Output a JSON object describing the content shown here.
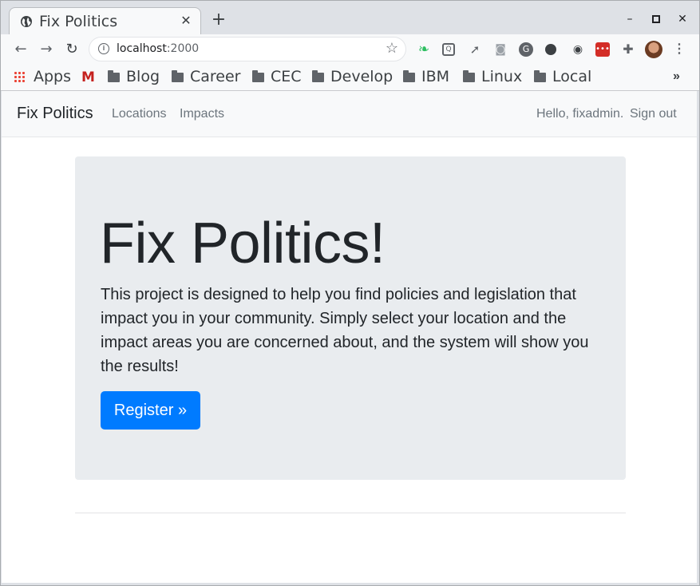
{
  "browser": {
    "tab": {
      "title": "Fix Politics",
      "close": "✕"
    },
    "new_tab": "+",
    "window_controls": {
      "minimize": "–",
      "maximize": "◻",
      "close": "✕"
    },
    "nav": {
      "back": "←",
      "forward": "→",
      "reload": "↻"
    },
    "address": {
      "host": "localhost",
      "port": ":2000"
    },
    "extensions": [
      "evernote-icon",
      "pocket-icon",
      "rocket-icon",
      "camera-icon",
      "grammarly-icon",
      "toggle-icon",
      "owl-icon",
      "lastpass-icon",
      "puzzle-icon"
    ],
    "bookmarks": [
      {
        "label": "Apps",
        "icon": "apps-grid-icon"
      },
      {
        "label": "",
        "icon": "gmail-icon"
      },
      {
        "label": "Blog",
        "icon": "folder-icon"
      },
      {
        "label": "Career",
        "icon": "folder-icon"
      },
      {
        "label": "CEC",
        "icon": "folder-icon"
      },
      {
        "label": "Develop",
        "icon": "folder-icon"
      },
      {
        "label": "IBM",
        "icon": "folder-icon"
      },
      {
        "label": "Linux",
        "icon": "folder-icon"
      },
      {
        "label": "Local",
        "icon": "folder-icon"
      }
    ],
    "bookmarks_overflow": "»"
  },
  "site": {
    "brand": "Fix Politics",
    "nav_links": [
      "Locations",
      "Impacts"
    ],
    "greeting": "Hello, fixadmin.",
    "sign_out": "Sign out"
  },
  "hero": {
    "title": "Fix Politics!",
    "body": "This project is designed to help you find policies and legislation that impact you in your community. Simply select your location and the impact areas you are concerned about, and the system will show you the results!",
    "button": "Register »"
  },
  "colors": {
    "primary": "#007bff",
    "jumbotron": "#e9ecef",
    "navbar": "#f8f9fa"
  }
}
